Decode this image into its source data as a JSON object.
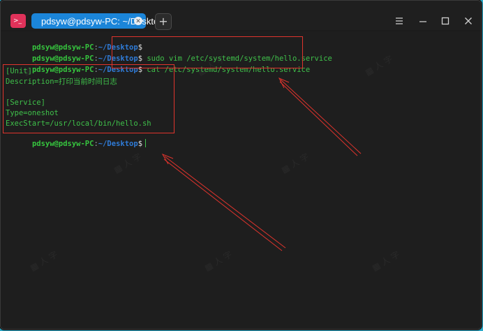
{
  "window": {
    "tab_title": "pdsyw@pdsyw-PC: ~/Desktop",
    "new_tab_label": "+"
  },
  "prompt": {
    "user_host": "pdsyw@pdsyw-PC",
    "sep": ":",
    "path": "~/Desktop",
    "dollar": "$"
  },
  "commands": [
    "",
    "sudo vim /etc/systemd/system/hello.service",
    "cat /etc/systemd/system/hello.service"
  ],
  "output": [
    "[Unit]",
    "Description=打印当前时间日志",
    "",
    "[Service]",
    "Type=oneshot",
    "ExecStart=/usr/local/bin/hello.sh"
  ],
  "colors": {
    "accent_tab": "#1b85d9",
    "prompt_user": "#36c43e",
    "prompt_path": "#2f7bd7",
    "annotation": "#e0342d"
  },
  "icons": {
    "app": "terminal-icon",
    "tab_close": "close-icon",
    "window_controls": [
      "menu-icon",
      "minimize-icon",
      "maximize-icon",
      "close-icon"
    ]
  }
}
